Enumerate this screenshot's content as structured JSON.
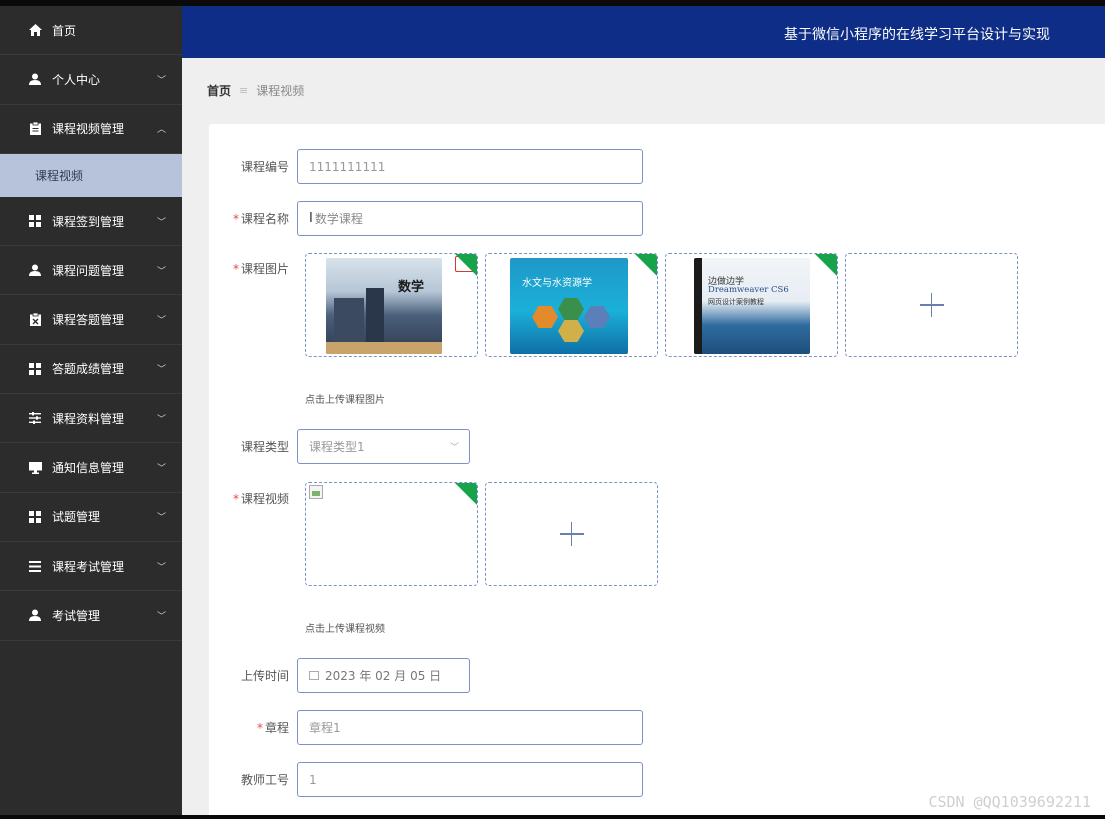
{
  "sidebar": {
    "items": [
      {
        "label": "首页",
        "icon": "home-icon",
        "chevron": ""
      },
      {
        "label": "个人中心",
        "icon": "user-icon",
        "chevron": "﹀"
      },
      {
        "label": "课程视频管理",
        "icon": "clipboard-icon",
        "chevron": "︿"
      },
      {
        "label": "课程签到管理",
        "icon": "grid-icon",
        "chevron": "﹀"
      },
      {
        "label": "课程问题管理",
        "icon": "user-icon",
        "chevron": "﹀"
      },
      {
        "label": "课程答题管理",
        "icon": "clipboard-x-icon",
        "chevron": "﹀"
      },
      {
        "label": "答题成绩管理",
        "icon": "grid-icon",
        "chevron": "﹀"
      },
      {
        "label": "课程资料管理",
        "icon": "sliders-icon",
        "chevron": "﹀"
      },
      {
        "label": "通知信息管理",
        "icon": "monitor-icon",
        "chevron": "﹀"
      },
      {
        "label": "试题管理",
        "icon": "grid-icon",
        "chevron": "﹀"
      },
      {
        "label": "课程考试管理",
        "icon": "list-icon",
        "chevron": "﹀"
      },
      {
        "label": "考试管理",
        "icon": "user-icon",
        "chevron": "﹀"
      }
    ],
    "sub_item": "课程视频"
  },
  "header": {
    "title": "基于微信小程序的在线学习平台设计与实现"
  },
  "breadcrumb": {
    "home": "首页",
    "separator": "≡",
    "current": "课程视频"
  },
  "form": {
    "course_no": {
      "label": "课程编号",
      "value": "1111111111"
    },
    "course_name": {
      "label": "课程名称",
      "value": "数学课程"
    },
    "course_image": {
      "label": "课程图片",
      "hint": "点击上传课程图片",
      "books": [
        {
          "title": "数学"
        },
        {
          "title": "水文与水资源学"
        },
        {
          "title": "边做边学",
          "subtitle": "Dreamweaver CS6",
          "subtitle2": "网页设计案例教程"
        }
      ]
    },
    "course_type": {
      "label": "课程类型",
      "value": "课程类型1"
    },
    "course_video": {
      "label": "课程视频",
      "hint": "点击上传课程视频"
    },
    "upload_time": {
      "label": "上传时间",
      "value": "2023 年 02 月 05 日"
    },
    "chapter": {
      "label": "章程",
      "value": "章程1"
    },
    "teacher_no": {
      "label": "教师工号",
      "value": "1"
    }
  },
  "watermark": "CSDN @QQ1039692211",
  "colors": {
    "header": "#0d2d86",
    "sidebar": "#2c2c2c",
    "active_sub": "#b7c3db",
    "required": "#e5484d",
    "upload_ok": "#17a34a"
  }
}
